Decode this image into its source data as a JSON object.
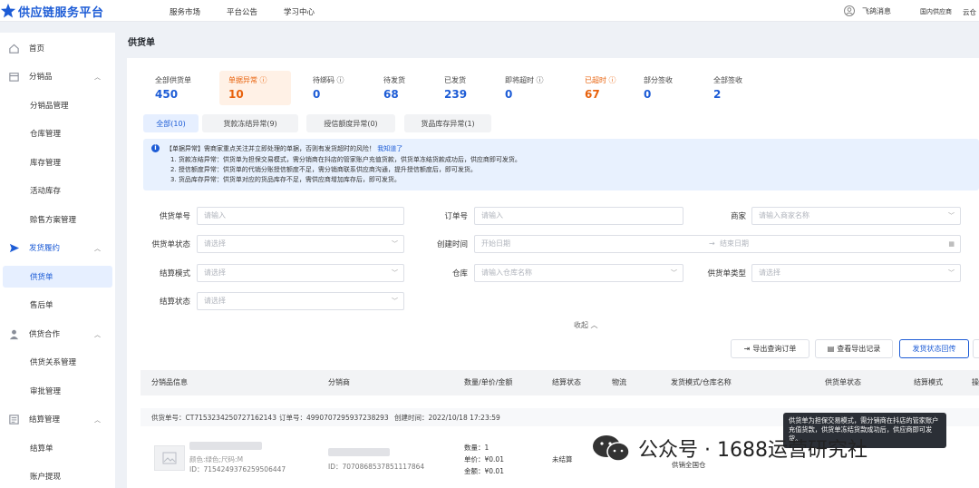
{
  "brand": {
    "title": "供应链服务平台"
  },
  "topnav": [
    "服务市场",
    "平台公告",
    "学习中心"
  ],
  "topright": {
    "message": "飞鸽消息",
    "region": "国内供应商",
    "shop": "云仓"
  },
  "sidebar": {
    "home": "首页",
    "g1": "分销品",
    "g1_items": [
      "分销品管理",
      "仓库管理",
      "库存管理",
      "活动库存",
      "赊售方案管理"
    ],
    "g2": "发货履约",
    "g2_items": [
      "供货单",
      "售后单"
    ],
    "g3": "供货合作",
    "g3_items": [
      "供货关系管理",
      "审批管理"
    ],
    "g4": "结算管理",
    "g4_items": [
      "结算单",
      "账户提现"
    ]
  },
  "page_title": "供货单",
  "stats": [
    {
      "label": "全部供货单",
      "value": "450"
    },
    {
      "label": "单据异常",
      "value": "10"
    },
    {
      "label": "待绑码",
      "value": "0"
    },
    {
      "label": "待发货",
      "value": "68"
    },
    {
      "label": "已发货",
      "value": "239"
    },
    {
      "label": "即将超时",
      "value": "0"
    },
    {
      "label": "已超时",
      "value": "67"
    },
    {
      "label": "部分签收",
      "value": "0"
    },
    {
      "label": "全部签收",
      "value": "2"
    }
  ],
  "subtabs": [
    "全部(10)",
    "货款冻结异常(9)",
    "授信额度异常(0)",
    "货品库存异常(1)"
  ],
  "alert": {
    "line1": "【单据异常】需商家重点关注并立即处理的单据，否则有发货超时的风险！",
    "link": "我知道了",
    "line2": "1. 货款冻结异常：供货单为担保交易模式，需分销商在抖店的管家账户充值货款，供货单冻结货款成功后，供应商即可发货。",
    "line3": "2. 授信额度异常：供货单的代销分账授信额度不足，需分销商联系供应商沟通，提升授信额度后，即可发货。",
    "line4": "3. 货品库存异常：供货单对应的货品库存不足，需供应商增加库存后，即可发货。"
  },
  "filters": {
    "supply_no": {
      "label": "供货单号",
      "placeholder": "请输入"
    },
    "order_no": {
      "label": "订单号",
      "placeholder": "请输入"
    },
    "merchant": {
      "label": "商家",
      "placeholder": "请输入商家名称"
    },
    "status": {
      "label": "供货单状态",
      "placeholder": "请选择"
    },
    "created": {
      "label": "创建时间",
      "start": "开始日期",
      "end": "结束日期",
      "sep": "→"
    },
    "settle_mode": {
      "label": "结算模式",
      "placeholder": "请选择"
    },
    "warehouse": {
      "label": "仓库",
      "placeholder": "请输入仓库名称"
    },
    "supply_type": {
      "label": "供货单类型",
      "placeholder": "请选择"
    },
    "settle_status": {
      "label": "结算状态",
      "placeholder": "请选择"
    }
  },
  "collapse": "收起",
  "buttons": {
    "export_query": "导出查询订单",
    "view_export": "查看导出记录",
    "ship_status": "发货状态回传"
  },
  "columns": [
    "分销品信息",
    "分销商",
    "数量/单价/金额",
    "结算状态",
    "物流",
    "发货模式/仓库名称",
    "供货单状态",
    "结算模式",
    "操"
  ],
  "order": {
    "supply_no": "供货单号：CT7153234250727162143",
    "order_no": "订单号：4990707295937238293",
    "created": "创建时间：2022/10/18 17:23:59",
    "product_sku": "颜色:绿色;尺码:M",
    "product_id": "ID：7154249376259506447",
    "distributor_id": "ID：7070868537851117864",
    "qty": "数量：1",
    "price": "单价：¥0.01",
    "amount": "金额：¥0.01",
    "settle": "未结算",
    "ship_mode": "供销全国仓"
  },
  "tooltip": "供货单为担保交易模式，需分销商在抖店的管家账户充值货款，供货单冻结货款成功后，供应商即可发货。",
  "watermark": "公众号 · 1688运营研究社",
  "colors": {
    "primary": "#1d5cd6",
    "warn": "#e8620c"
  }
}
